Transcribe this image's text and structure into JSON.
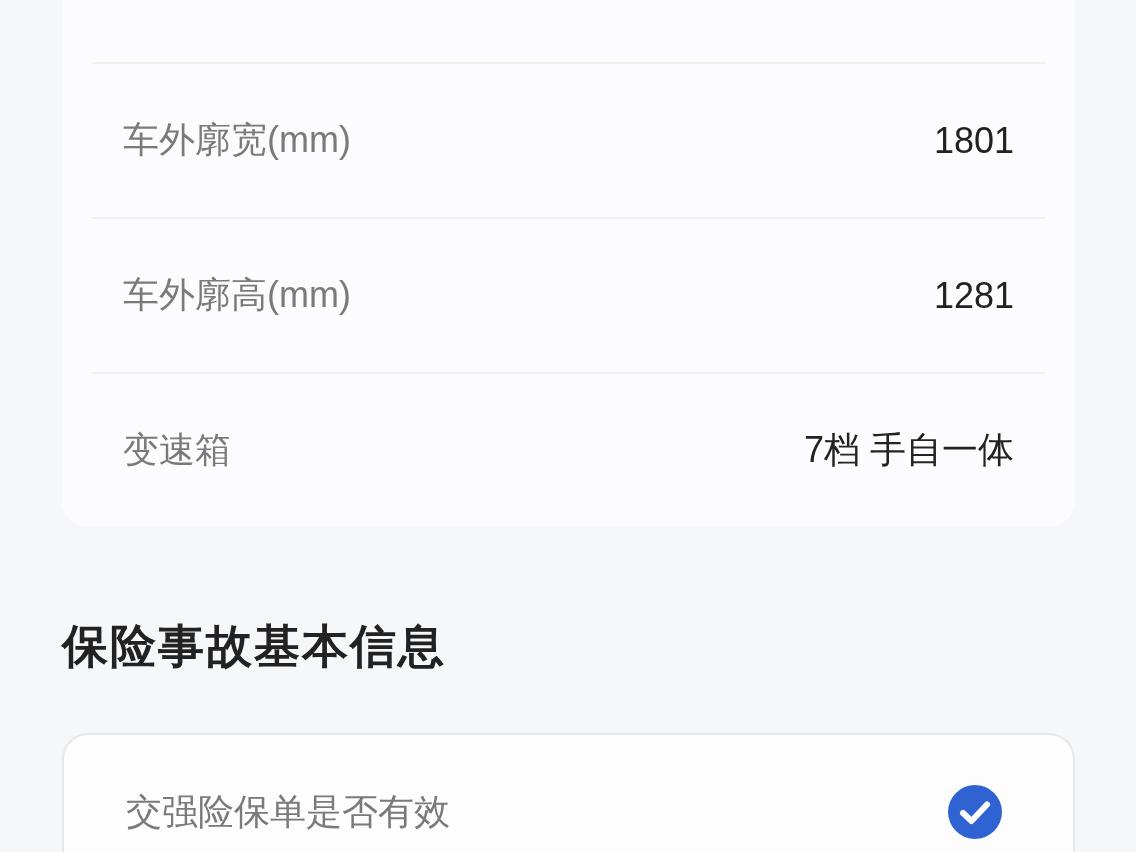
{
  "vehicle_specs": {
    "rows": [
      {
        "label": "车外廓宽(mm)",
        "value": "1801"
      },
      {
        "label": "车外廓高(mm)",
        "value": "1281"
      },
      {
        "label": "变速箱",
        "value": "7档 手自一体"
      }
    ]
  },
  "insurance_section": {
    "title": "保险事故基本信息",
    "rows": [
      {
        "label": "交强险保单是否有效",
        "checked": true
      }
    ]
  }
}
